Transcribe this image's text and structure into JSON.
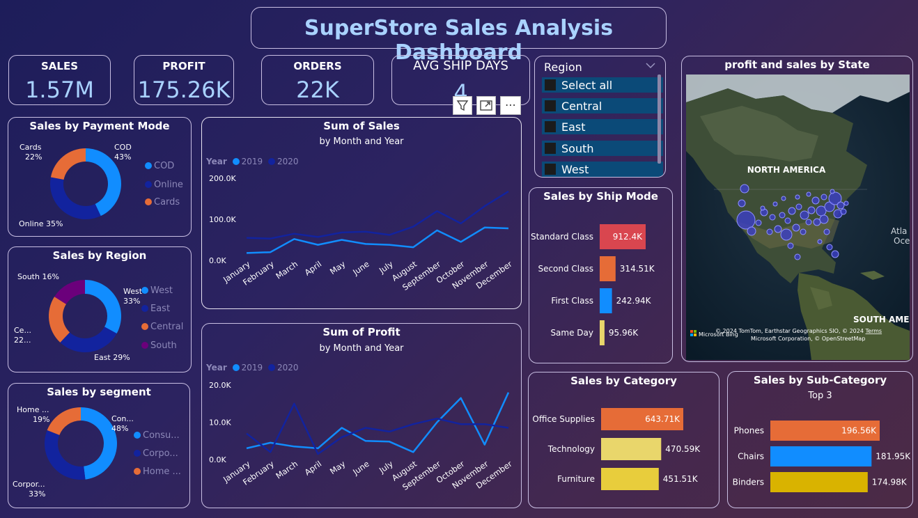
{
  "title": "SuperStore Sales Analysis Dashboard",
  "kpis": {
    "sales": {
      "label": "SALES",
      "value": "1.57M"
    },
    "profit": {
      "label": "PROFIT",
      "value": "175.26K"
    },
    "orders": {
      "label": "ORDERS",
      "value": "22K"
    },
    "ship": {
      "label": "AVG SHIP DAYS",
      "value": "4"
    }
  },
  "visual_header": {
    "filter_icon": "filter-icon",
    "focus_icon": "focus-mode-icon",
    "more": "⋯"
  },
  "payment": {
    "title": "Sales by Payment Mode",
    "slices": [
      {
        "name": "COD",
        "pct": 43,
        "color": "#118dff"
      },
      {
        "name": "Online",
        "pct": 35,
        "color": "#12239e"
      },
      {
        "name": "Cards",
        "pct": 22,
        "color": "#e66c37"
      }
    ],
    "labels": {
      "cod_name": "COD",
      "cod_pct": "43%",
      "online": "Online 35%",
      "cards_name": "Cards",
      "cards_pct": "22%"
    },
    "legend": [
      "COD",
      "Online",
      "Cards"
    ]
  },
  "region_donut": {
    "title": "Sales by Region",
    "slices": [
      {
        "name": "West",
        "pct": 33,
        "color": "#118dff"
      },
      {
        "name": "East",
        "pct": 29,
        "color": "#12239e"
      },
      {
        "name": "Central",
        "pct": 22,
        "color": "#e66c37"
      },
      {
        "name": "South",
        "pct": 16,
        "color": "#6b007b"
      }
    ],
    "labels": {
      "west_name": "West",
      "west_pct": "33%",
      "east": "East 29%",
      "central_name": "Ce...",
      "central_pct": "22...",
      "south": "South 16%"
    },
    "legend": [
      "West",
      "East",
      "Central",
      "South"
    ]
  },
  "segment": {
    "title": "Sales by segment",
    "slices": [
      {
        "name": "Consumer",
        "pct": 48,
        "color": "#118dff"
      },
      {
        "name": "Corporate",
        "pct": 33,
        "color": "#12239e"
      },
      {
        "name": "Home Office",
        "pct": 19,
        "color": "#e66c37"
      }
    ],
    "labels": {
      "con_name": "Con...",
      "con_pct": "48%",
      "corp_name": "Corpor...",
      "corp_pct": "33%",
      "home_name": "Home ...",
      "home_pct": "19%"
    },
    "legend": [
      "Consu...",
      "Corpo...",
      "Home ..."
    ]
  },
  "sales_chart": {
    "title": "Sum of Sales",
    "subtitle": "by Month and Year",
    "legend_title": "Year",
    "years": [
      "2019",
      "2020"
    ]
  },
  "profit_chart": {
    "title": "Sum of Profit",
    "subtitle": "by Month and Year",
    "legend_title": "Year",
    "years": [
      "2019",
      "2020"
    ]
  },
  "chart_data": [
    {
      "type": "line",
      "title": "Sum of Sales",
      "subtitle": "by Month and Year",
      "legend_title": "Year",
      "categories": [
        "January",
        "February",
        "March",
        "April",
        "May",
        "June",
        "July",
        "August",
        "September",
        "October",
        "November",
        "December"
      ],
      "series": [
        {
          "name": "2019",
          "color": "#118dff",
          "values": [
            18000,
            20000,
            52000,
            38000,
            50000,
            40000,
            38000,
            32000,
            73000,
            45000,
            80000,
            78000
          ]
        },
        {
          "name": "2020",
          "color": "#12239e",
          "values": [
            55000,
            53000,
            65000,
            57000,
            68000,
            70000,
            62000,
            82000,
            120000,
            90000,
            132000,
            168000
          ]
        }
      ],
      "yticks": [
        "0.0K",
        "100.0K",
        "200.0K"
      ],
      "ylim": [
        0,
        200000
      ]
    },
    {
      "type": "line",
      "title": "Sum of Profit",
      "subtitle": "by Month and Year",
      "legend_title": "Year",
      "categories": [
        "January",
        "February",
        "March",
        "April",
        "May",
        "June",
        "July",
        "August",
        "September",
        "October",
        "November",
        "December"
      ],
      "series": [
        {
          "name": "2019",
          "color": "#118dff",
          "values": [
            3000,
            4500,
            3500,
            3000,
            8500,
            5000,
            4800,
            2000,
            10000,
            16500,
            4000,
            18000
          ]
        },
        {
          "name": "2020",
          "color": "#12239e",
          "values": [
            7000,
            2000,
            15000,
            1500,
            6000,
            8500,
            7500,
            9500,
            11000,
            9500,
            9500,
            8500
          ]
        }
      ],
      "yticks": [
        "0.0K",
        "10.0K",
        "20.0K"
      ],
      "ylim": [
        0,
        20000
      ]
    },
    {
      "type": "bar",
      "title": "Sales by Ship Mode",
      "categories": [
        "Standard Class",
        "Second Class",
        "First Class",
        "Same Day"
      ],
      "values": [
        912.4,
        314.51,
        242.94,
        95.96
      ],
      "labels": [
        "912.4K",
        "314.51K",
        "242.94K",
        "95.96K"
      ],
      "colors": [
        "#d9464f",
        "#e66c37",
        "#118dff",
        "#e9d66b"
      ]
    },
    {
      "type": "bar",
      "title": "Sales by Category",
      "categories": [
        "Office Supplies",
        "Technology",
        "Furniture"
      ],
      "values": [
        643.71,
        470.59,
        451.51
      ],
      "labels": [
        "643.71K",
        "470.59K",
        "451.51K"
      ],
      "colors": [
        "#e66c37",
        "#e9d66b",
        "#e8cd3c"
      ]
    },
    {
      "type": "bar",
      "title": "Sales by Sub-Category",
      "subtitle": "Top 3",
      "categories": [
        "Phones",
        "Chairs",
        "Binders"
      ],
      "values": [
        196.56,
        181.95,
        174.98
      ],
      "labels": [
        "196.56K",
        "181.95K",
        "174.98K"
      ],
      "colors": [
        "#e66c37",
        "#118dff",
        "#d9b300"
      ]
    }
  ],
  "region_slicer": {
    "title": "Region",
    "items": [
      "Select all",
      "Central",
      "East",
      "South",
      "West"
    ]
  },
  "map": {
    "title": "profit and sales by State",
    "labels": {
      "na": "NORTH AMERICA",
      "sa": "SOUTH AMER",
      "atl1": "Atla",
      "atl2": "Oce"
    },
    "attribution1": "© 2024 TomTom, Earthstar Geographics SIO, © 2024",
    "attribution_terms": "Terms",
    "attribution2": "Microsoft Corporation, © OpenStreetMap",
    "bing": "Microsoft Bing"
  }
}
